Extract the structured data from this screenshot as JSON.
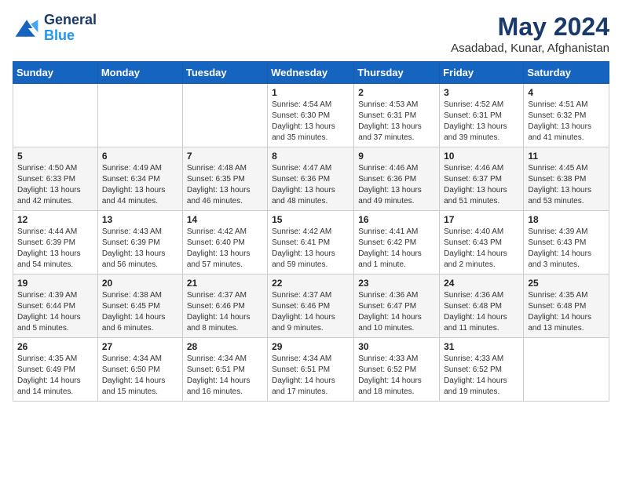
{
  "header": {
    "logo_line1": "General",
    "logo_line2": "Blue",
    "title": "May 2024",
    "subtitle": "Asadabad, Kunar, Afghanistan"
  },
  "days_of_week": [
    "Sunday",
    "Monday",
    "Tuesday",
    "Wednesday",
    "Thursday",
    "Friday",
    "Saturday"
  ],
  "weeks": [
    [
      {
        "day": "",
        "info": ""
      },
      {
        "day": "",
        "info": ""
      },
      {
        "day": "",
        "info": ""
      },
      {
        "day": "1",
        "info": "Sunrise: 4:54 AM\nSunset: 6:30 PM\nDaylight: 13 hours and 35 minutes."
      },
      {
        "day": "2",
        "info": "Sunrise: 4:53 AM\nSunset: 6:31 PM\nDaylight: 13 hours and 37 minutes."
      },
      {
        "day": "3",
        "info": "Sunrise: 4:52 AM\nSunset: 6:31 PM\nDaylight: 13 hours and 39 minutes."
      },
      {
        "day": "4",
        "info": "Sunrise: 4:51 AM\nSunset: 6:32 PM\nDaylight: 13 hours and 41 minutes."
      }
    ],
    [
      {
        "day": "5",
        "info": "Sunrise: 4:50 AM\nSunset: 6:33 PM\nDaylight: 13 hours and 42 minutes."
      },
      {
        "day": "6",
        "info": "Sunrise: 4:49 AM\nSunset: 6:34 PM\nDaylight: 13 hours and 44 minutes."
      },
      {
        "day": "7",
        "info": "Sunrise: 4:48 AM\nSunset: 6:35 PM\nDaylight: 13 hours and 46 minutes."
      },
      {
        "day": "8",
        "info": "Sunrise: 4:47 AM\nSunset: 6:36 PM\nDaylight: 13 hours and 48 minutes."
      },
      {
        "day": "9",
        "info": "Sunrise: 4:46 AM\nSunset: 6:36 PM\nDaylight: 13 hours and 49 minutes."
      },
      {
        "day": "10",
        "info": "Sunrise: 4:46 AM\nSunset: 6:37 PM\nDaylight: 13 hours and 51 minutes."
      },
      {
        "day": "11",
        "info": "Sunrise: 4:45 AM\nSunset: 6:38 PM\nDaylight: 13 hours and 53 minutes."
      }
    ],
    [
      {
        "day": "12",
        "info": "Sunrise: 4:44 AM\nSunset: 6:39 PM\nDaylight: 13 hours and 54 minutes."
      },
      {
        "day": "13",
        "info": "Sunrise: 4:43 AM\nSunset: 6:39 PM\nDaylight: 13 hours and 56 minutes."
      },
      {
        "day": "14",
        "info": "Sunrise: 4:42 AM\nSunset: 6:40 PM\nDaylight: 13 hours and 57 minutes."
      },
      {
        "day": "15",
        "info": "Sunrise: 4:42 AM\nSunset: 6:41 PM\nDaylight: 13 hours and 59 minutes."
      },
      {
        "day": "16",
        "info": "Sunrise: 4:41 AM\nSunset: 6:42 PM\nDaylight: 14 hours and 1 minute."
      },
      {
        "day": "17",
        "info": "Sunrise: 4:40 AM\nSunset: 6:43 PM\nDaylight: 14 hours and 2 minutes."
      },
      {
        "day": "18",
        "info": "Sunrise: 4:39 AM\nSunset: 6:43 PM\nDaylight: 14 hours and 3 minutes."
      }
    ],
    [
      {
        "day": "19",
        "info": "Sunrise: 4:39 AM\nSunset: 6:44 PM\nDaylight: 14 hours and 5 minutes."
      },
      {
        "day": "20",
        "info": "Sunrise: 4:38 AM\nSunset: 6:45 PM\nDaylight: 14 hours and 6 minutes."
      },
      {
        "day": "21",
        "info": "Sunrise: 4:37 AM\nSunset: 6:46 PM\nDaylight: 14 hours and 8 minutes."
      },
      {
        "day": "22",
        "info": "Sunrise: 4:37 AM\nSunset: 6:46 PM\nDaylight: 14 hours and 9 minutes."
      },
      {
        "day": "23",
        "info": "Sunrise: 4:36 AM\nSunset: 6:47 PM\nDaylight: 14 hours and 10 minutes."
      },
      {
        "day": "24",
        "info": "Sunrise: 4:36 AM\nSunset: 6:48 PM\nDaylight: 14 hours and 11 minutes."
      },
      {
        "day": "25",
        "info": "Sunrise: 4:35 AM\nSunset: 6:48 PM\nDaylight: 14 hours and 13 minutes."
      }
    ],
    [
      {
        "day": "26",
        "info": "Sunrise: 4:35 AM\nSunset: 6:49 PM\nDaylight: 14 hours and 14 minutes."
      },
      {
        "day": "27",
        "info": "Sunrise: 4:34 AM\nSunset: 6:50 PM\nDaylight: 14 hours and 15 minutes."
      },
      {
        "day": "28",
        "info": "Sunrise: 4:34 AM\nSunset: 6:51 PM\nDaylight: 14 hours and 16 minutes."
      },
      {
        "day": "29",
        "info": "Sunrise: 4:34 AM\nSunset: 6:51 PM\nDaylight: 14 hours and 17 minutes."
      },
      {
        "day": "30",
        "info": "Sunrise: 4:33 AM\nSunset: 6:52 PM\nDaylight: 14 hours and 18 minutes."
      },
      {
        "day": "31",
        "info": "Sunrise: 4:33 AM\nSunset: 6:52 PM\nDaylight: 14 hours and 19 minutes."
      },
      {
        "day": "",
        "info": ""
      }
    ]
  ]
}
